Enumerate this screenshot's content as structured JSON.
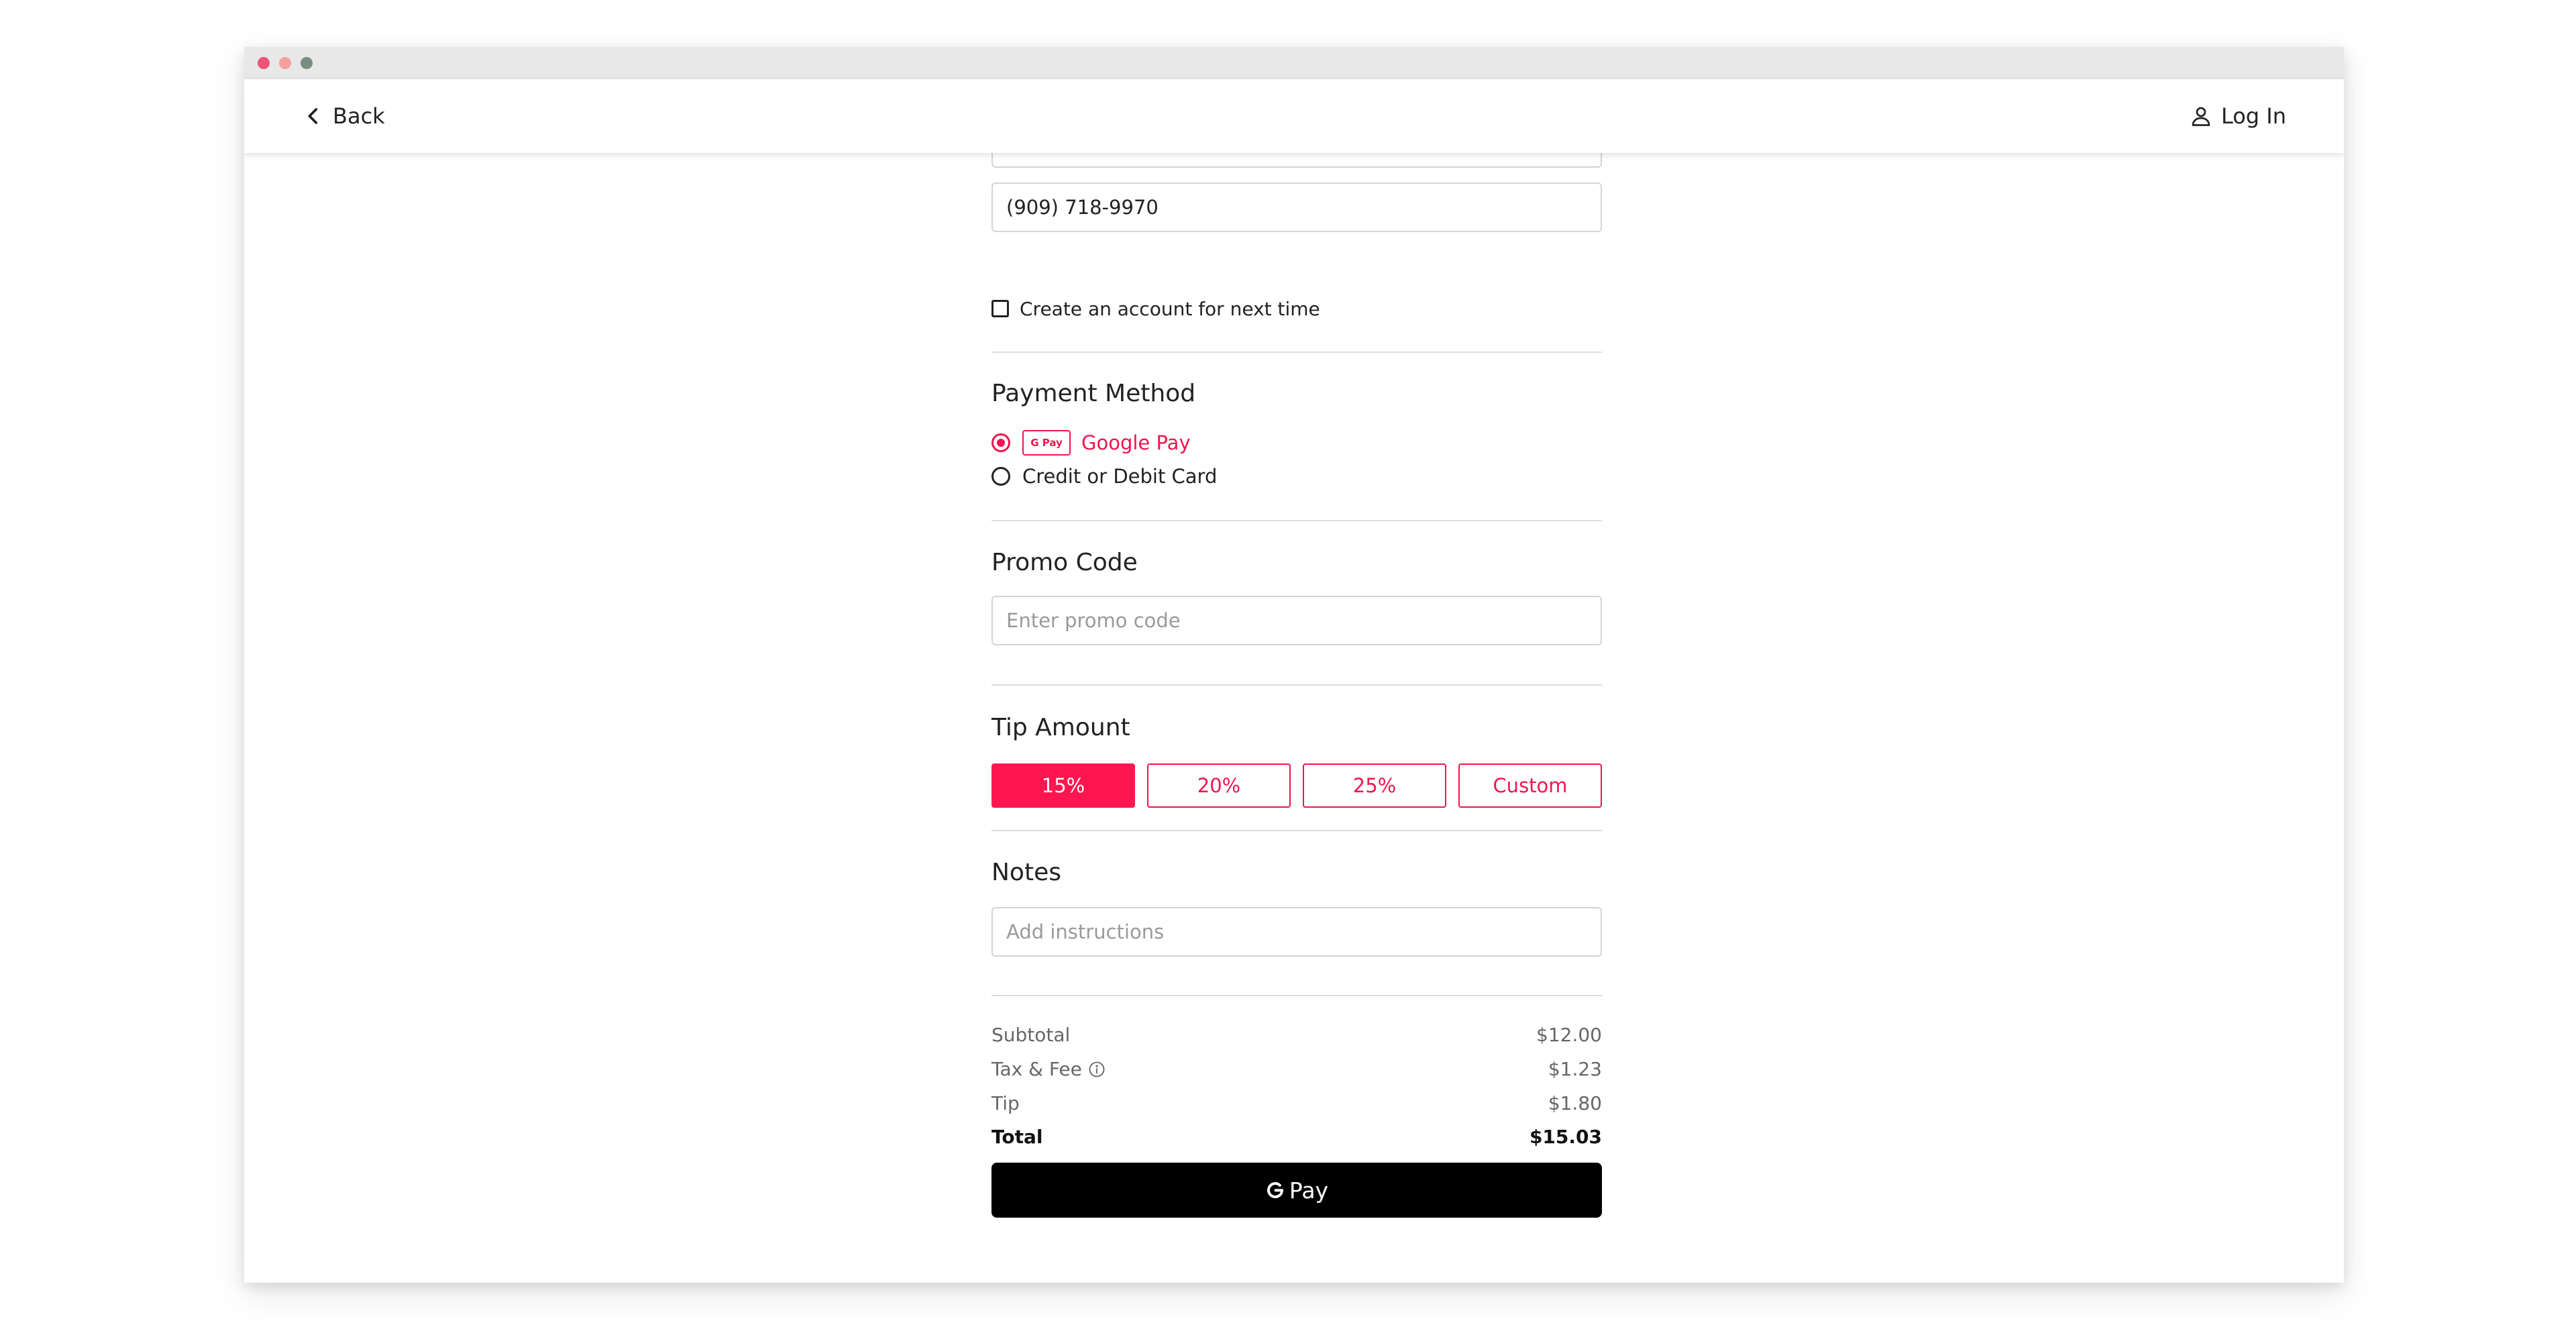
{
  "header": {
    "back_label": "Back",
    "login_label": "Log In"
  },
  "contact": {
    "phone_value": "(909) 718-9970",
    "create_account_label": "Create an account for next time",
    "create_account_checked": false
  },
  "payment": {
    "title": "Payment Method",
    "options": [
      {
        "badge": "G Pay",
        "label": "Google Pay",
        "selected": true
      },
      {
        "label": "Credit or Debit Card",
        "selected": false
      }
    ]
  },
  "promo": {
    "title": "Promo Code",
    "placeholder": "Enter promo code"
  },
  "tip": {
    "title": "Tip Amount",
    "options": [
      "15%",
      "20%",
      "25%",
      "Custom"
    ],
    "selected": "15%"
  },
  "notes": {
    "title": "Notes",
    "placeholder": "Add instructions"
  },
  "summary": {
    "subtotal_label": "Subtotal",
    "subtotal_value": "$12.00",
    "tax_label": "Tax & Fee",
    "tax_value": "$1.23",
    "tip_label": "Tip",
    "tip_value": "$1.80",
    "total_label": "Total",
    "total_value": "$15.03"
  },
  "pay_button": {
    "label": "Pay"
  },
  "colors": {
    "accent": "#ff1650",
    "button_dark": "#000000"
  }
}
